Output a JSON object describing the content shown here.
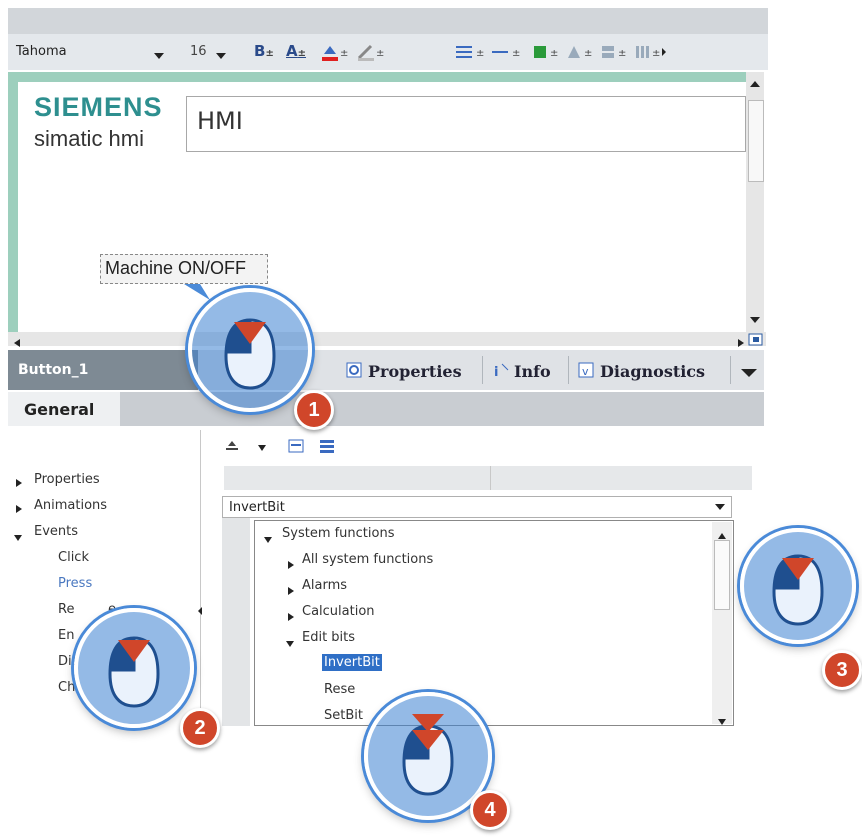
{
  "toolbar": {
    "font_family_value": "Tahoma",
    "font_size_value": "16",
    "bold_label": "B",
    "text_color_label": "A"
  },
  "canvas": {
    "brand": "SIEMENS",
    "subtitle": "simatic hmi",
    "hmi_field_text": "HMI",
    "machine_button_label": "Machine ON/OFF"
  },
  "inspector": {
    "object_name": "Button_1",
    "tabs": [
      {
        "label": "Properties",
        "icon": "properties-icon"
      },
      {
        "label": "Info",
        "icon": "info-icon"
      },
      {
        "label": "Diagnostics",
        "icon": "diagnostics-icon"
      }
    ],
    "general_tab": "General"
  },
  "nav": {
    "items": [
      "Properties",
      "Animations",
      "Events"
    ],
    "events": [
      "Click",
      "Press",
      "Re",
      "e",
      "En",
      "Dis",
      "Ch"
    ]
  },
  "events_grid": {
    "selected_function": "InvertBit"
  },
  "dropdown": {
    "items": [
      {
        "label": "System functions",
        "state": "expanded"
      },
      {
        "label": "All system functions",
        "state": "collapsed"
      },
      {
        "label": "Alarms",
        "state": "collapsed"
      },
      {
        "label": "Calculation",
        "state": "collapsed"
      },
      {
        "label": "Edit bits",
        "state": "expanded"
      },
      {
        "label": "InvertBit",
        "state": "selected"
      },
      {
        "label": "Rese",
        "state": "leaf"
      },
      {
        "label": "SetBit",
        "state": "leaf"
      }
    ]
  },
  "callouts": [
    "1",
    "2",
    "3",
    "4"
  ],
  "colors": {
    "brand_teal": "#2e8f8f",
    "callout_blue": "#4a8ad8",
    "badge_red": "#d0462a",
    "selection_blue": "#2f6fc6"
  }
}
